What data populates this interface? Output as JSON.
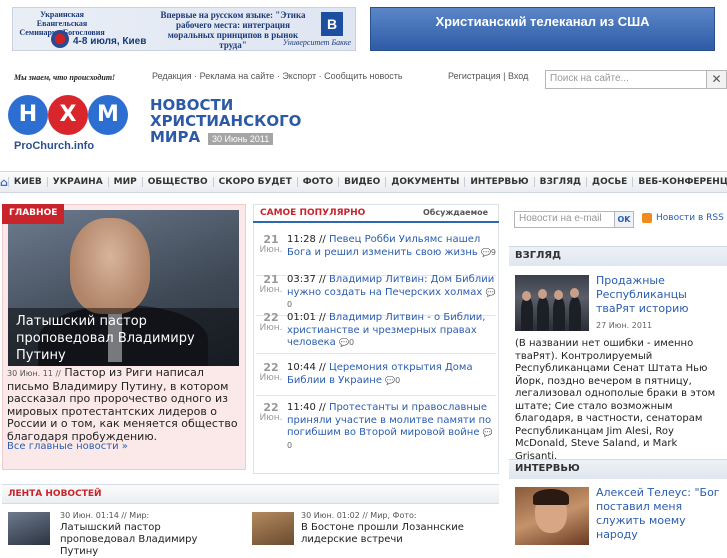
{
  "banners": {
    "left": {
      "org": "Украинская Евангельская Семинария Богословия",
      "date": "4-8 июля, Киев",
      "headline": "Впервые на русском языке: \"Этика рабочего места: интеграция моральных принципов в рынок труда\"",
      "logo": "B",
      "university": "Университет Бакке"
    },
    "right": {
      "text": "Христианский телеканал из США"
    }
  },
  "header": {
    "slogan": "Мы знаем, что происходит!",
    "nav": [
      "Редакция",
      "Реклама на сайте",
      "Экспорт",
      "Сообщить новость"
    ],
    "auth": {
      "register": "Регистрация",
      "sep": "|",
      "login": "Вход"
    },
    "search_placeholder": "Поиск на сайте...",
    "logo_letters": [
      "Н",
      "Х",
      "М"
    ],
    "logo_text": "ProChurch.info",
    "site_title": "НОВОСТИ ХРИСТИАНСКОГО МИРА",
    "site_date": "30 Июнь 2011"
  },
  "main_nav": [
    "КИЕВ",
    "УКРАИНА",
    "МИР",
    "ОБЩЕСТВО",
    "СКОРО БУДЕТ",
    "ФОТО",
    "ВИДЕО",
    "ДОКУМЕНТЫ",
    "ИНТЕРВЬЮ",
    "ВЗГЛЯД",
    "ДОСЬЕ",
    "ВЕБ-КОНФЕРЕНЦИЯ"
  ],
  "main_story": {
    "tag": "ГЛАВНОЕ",
    "caption": "Латышский пастор проповедовал Владимиру Путину",
    "date": "30 Июн. 11 //",
    "text": "Пастор из Риги написал письмо Владимиру Путину, в котором рассказал про пророчество одного из мировых протестантских лидеров о России и о том, как меняется общество благодаря пробуждению.",
    "all_link": "Все главные новости »"
  },
  "popular": {
    "tab_active": "САМОЕ ПОПУЛЯРНО",
    "tab_other": "Обсуждаемое",
    "items": [
      {
        "day": "21",
        "mon": "Июн.",
        "time": "11:28 //",
        "title": "Певец Робби Уильямс нашел Бога и решил изменить свою жизнь",
        "comments": "9"
      },
      {
        "day": "21",
        "mon": "Июн.",
        "time": "03:37 //",
        "title": "Владимир Литвин: Дом Библии нужно создать на Печерских холмах",
        "comments": "0"
      },
      {
        "day": "22",
        "mon": "Июн.",
        "time": "01:01 //",
        "title": "Владимир Литвин - о Библии, христианстве и чрезмерных правах человека",
        "comments": "0"
      },
      {
        "day": "22",
        "mon": "Июн.",
        "time": "10:44 //",
        "title": "Церемония открытия Дома Библии в Украине",
        "comments": "0"
      },
      {
        "day": "22",
        "mon": "Июн.",
        "time": "11:40 //",
        "title": "Протестанты и православные приняли участие в молитве памяти по погибшим во Второй мировой войне",
        "comments": "0"
      }
    ]
  },
  "sidebar": {
    "newsletter_placeholder": "Новости на e-mail",
    "ok": "OK",
    "rss": "Новости в RSS",
    "vzglyad": {
      "heading": "ВЗГЛЯД",
      "title": "Продажные Республиканцы тваРят историю",
      "date": "27 Июн. 2011",
      "body": "(В названии нет ошибки - именно тваРят). Контролируемый Республиканцами Сенат Штата Нью Йорк, поздно вечером в пятницу, легализовал однополые браки в этом штате; Сие стало возможным благодаря, в частности, сенаторам Республиканцам Jim Alesi, Roy McDonald, Steve Saland, и Mark Grisanti."
    },
    "interview": {
      "heading": "ИНТЕРВЬЮ",
      "title": "Алексей Телеус: \"Бог поставил меня служить моему народу"
    }
  },
  "lenta": {
    "heading": "ЛЕНТА НОВОСТЕЙ",
    "items": [
      {
        "meta": "30 Июн. 01:14 // Мир:",
        "title": "Латышский пастор проповедовал Владимиру Путину"
      },
      {
        "meta": "30 Июн. 01:02 // Мир, Фото:",
        "title": "В Бостоне прошли Лозаннские лидерские встречи"
      }
    ]
  },
  "colors": {
    "accent_red": "#c8242a",
    "link_blue": "#2a5db0",
    "logo_blue": "#2d5aa6",
    "logo_red": "#d8262c"
  }
}
